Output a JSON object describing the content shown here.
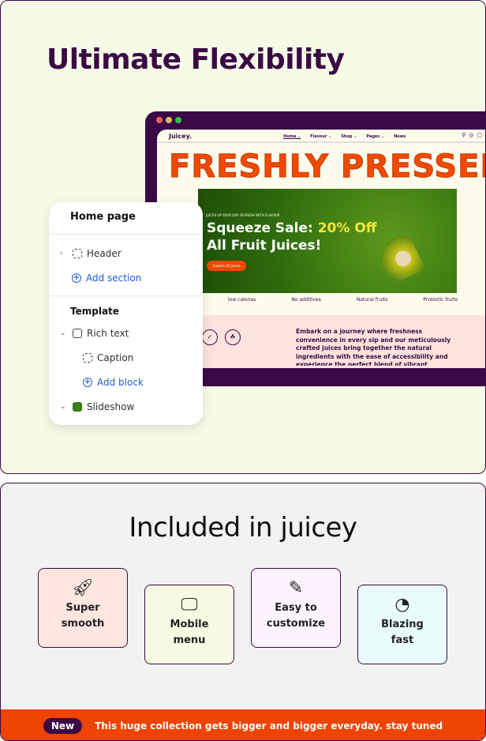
{
  "top": {
    "title": "Ultimate Flexibility"
  },
  "browser": {
    "dots": [
      "#f0605a",
      "#d8c160",
      "#33c24a"
    ],
    "logo": "Juicey.",
    "nav": [
      "Home ⌄",
      "Flavour ⌄",
      "Shop ⌄",
      "Pages ⌄",
      "News"
    ],
    "icons": [
      "search-icon",
      "user-icon",
      "cart-icon"
    ],
    "headline": "FRESHLY PRESSED",
    "banner": {
      "eyebrow": "JUICES UP YOUR DAY: REFRESH WITH FLAVOUR",
      "line1a": "Squeeze Sale: ",
      "line1b": "20% Off",
      "line2": "All Fruit Juices!",
      "button": "Explore All Juices"
    },
    "strip": [
      "low calories",
      "No additives",
      "Natural fruits",
      "Probiotic fruits"
    ],
    "body": "Embark on a journey where freshness convenience in every sip and our meticulously crafted juices bring together the natural ingredients with the ease of accessibility and experience the perfect blend of vibrant flavours"
  },
  "panel": {
    "title": "Home page",
    "header": "Header",
    "add_section": "Add section",
    "template": "Template",
    "rich_text": "Rich text",
    "caption": "Caption",
    "add_block": "Add block",
    "slideshow": "Slideshow"
  },
  "included": {
    "title": "Included in juicey",
    "cards": [
      {
        "label": "Super\nsmooth",
        "icon": "rocket-icon",
        "color": "#fde6e0"
      },
      {
        "label": "Mobile\nmenu",
        "icon": "devices-icon",
        "color": "#f8fbe3"
      },
      {
        "label": "Easy to\ncustomize",
        "icon": "ruler-pencil-icon",
        "color": "#fdf3ff"
      },
      {
        "label": "Blazing\nfast",
        "icon": "speedometer-icon",
        "color": "#e8fdfb"
      }
    ]
  },
  "footer": {
    "badge": "New",
    "text": "This huge collection gets bigger and bigger everyday. stay tuned"
  }
}
